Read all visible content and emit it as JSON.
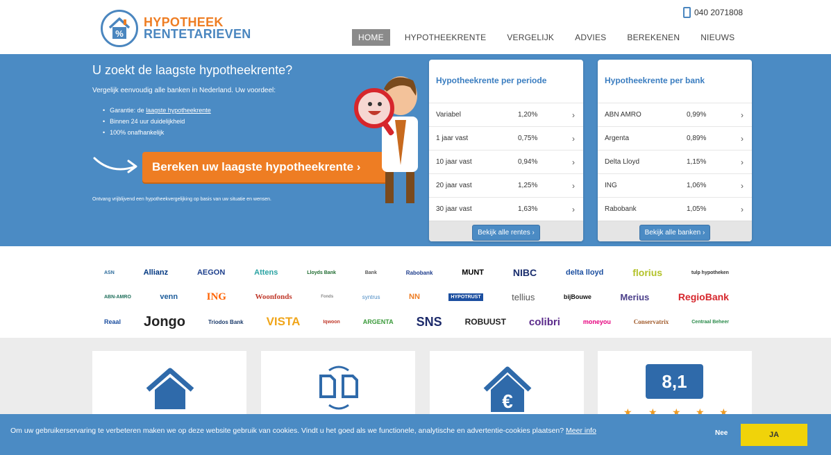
{
  "header": {
    "logo_line1": "HYPOTHEEK",
    "logo_line2": "RENTETARIEVEN",
    "phone": "040 2071808",
    "nav": [
      "HOME",
      "HYPOTHEEKRENTE",
      "VERGELIJK",
      "ADVIES",
      "BEREKENEN",
      "NIEUWS"
    ]
  },
  "hero": {
    "title": "U zoekt de laagste hypotheekrente?",
    "subtitle": "Vergelijk eenvoudig alle banken in Nederland. Uw voordeel:",
    "bullet1_prefix": "Garantie: de ",
    "bullet1_link": "laagste hypotheekrente",
    "bullet2": "Binnen 24 uur duidelijkheid",
    "bullet3": "100% onafhankelijk",
    "cta": "Bereken uw laagste hypotheekrente ›",
    "footnote": "Ontvang vrijblijvend een hypotheekvergelijking op basis van uw situatie en wensen."
  },
  "card_periode": {
    "title": "Hypotheekrente per periode",
    "rows": [
      {
        "name": "Variabel",
        "rate": "1,20%"
      },
      {
        "name": "1 jaar vast",
        "rate": "0,75%"
      },
      {
        "name": "10 jaar vast",
        "rate": "0,94%"
      },
      {
        "name": "20 jaar vast",
        "rate": "1,25%"
      },
      {
        "name": "30 jaar vast",
        "rate": "1,63%"
      }
    ],
    "button": "Bekijk alle rentes ›"
  },
  "card_bank": {
    "title": "Hypotheekrente per bank",
    "rows": [
      {
        "name": "ABN AMRO",
        "rate": "0,99%"
      },
      {
        "name": "Argenta",
        "rate": "0,89%"
      },
      {
        "name": "Delta Lloyd",
        "rate": "1,15%"
      },
      {
        "name": "ING",
        "rate": "1,06%"
      },
      {
        "name": "Rabobank",
        "rate": "1,05%"
      }
    ],
    "button": "Bekijk alle banken ›"
  },
  "logos": {
    "row1": [
      "ASN",
      "Allianz",
      "AEGON",
      "Attens",
      "Lloyds Bank",
      "Bank",
      "Rabobank",
      "MUNT",
      "NIBC",
      "delta lloyd",
      "florius",
      "tulp hypotheken"
    ],
    "row2": [
      "ABN-AMRO",
      "venn",
      "ING",
      "Woonfonds",
      "Fonds",
      "syntrus",
      "NN",
      "HYPOTRUST",
      "tellius",
      "bijBouwe",
      "Merius",
      "RegioBank"
    ],
    "row3": [
      "Reaal",
      "Jongo",
      "Triodos Bank",
      "VISTA",
      "Iqwoon",
      "ARGENTA",
      "SNS",
      "ROBUUST",
      "colibri",
      "moneyou",
      "Conservatrix",
      "Centraal Beheer"
    ]
  },
  "features": {
    "rating": "8,1"
  },
  "cookie": {
    "text": "Om uw gebruikerservaring te verbeteren maken we op deze website gebruik van cookies. Vindt u het goed als we functionele, analytische en advertentie-cookies plaatsen?",
    "link": "Meer info",
    "nee": "Nee",
    "ja": "JA"
  },
  "colors": {
    "brand_blue": "#4b8bc4",
    "brand_orange": "#ee7d23",
    "cookie_yes": "#f0d30a"
  }
}
